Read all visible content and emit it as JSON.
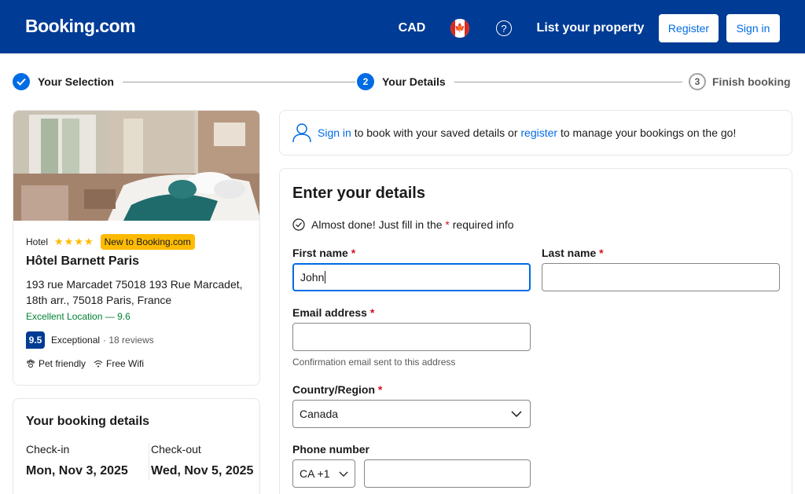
{
  "header": {
    "logo": "Booking.com",
    "currency": "CAD",
    "help_symbol": "?",
    "list_property": "List your property",
    "register": "Register",
    "sign_in": "Sign in",
    "brand_color": "#003b95",
    "accent_color": "#006ce4"
  },
  "progress": {
    "steps": [
      {
        "number": "✓",
        "label": "Your Selection",
        "state": "done"
      },
      {
        "number": "2",
        "label": "Your Details",
        "state": "current"
      },
      {
        "number": "3",
        "label": "Finish booking",
        "state": "upcoming"
      }
    ]
  },
  "hotel": {
    "type": "Hotel",
    "stars": "★★★★",
    "badge": "New to Booking.com",
    "name": "Hôtel Barnett Paris",
    "address": "193 rue Marcadet 75018 193 Rue Marcadet, 18th arr., 75018 Paris, France",
    "location": "Excellent Location — 9.6",
    "score": "9.5",
    "score_word": "Exceptional",
    "reviews": "· 18 reviews",
    "amenities": [
      "Pet friendly",
      "Free Wifi"
    ]
  },
  "booking": {
    "title": "Your booking details",
    "checkin_label": "Check-in",
    "checkin_value": "Mon, Nov 3, 2025",
    "checkout_label": "Check-out",
    "checkout_value": "Wed, Nov 5, 2025"
  },
  "signin_banner": {
    "sign_in_link": "Sign in",
    "text_middle": " to book with your saved details or ",
    "register_link": "register",
    "text_end": " to manage your bookings on the go!"
  },
  "form": {
    "title": "Enter your details",
    "almost_done_prefix": "Almost done! Just fill in the ",
    "required_mark": "*",
    "almost_done_suffix": " required info",
    "first_name_label": "First name",
    "first_name_value": "John",
    "last_name_label": "Last name",
    "last_name_value": "",
    "email_label": "Email address",
    "email_value": "",
    "email_helper": "Confirmation email sent to this address",
    "country_label": "Country/Region",
    "country_value": "Canada",
    "phone_label": "Phone number",
    "phone_code": "CA +1",
    "phone_value": ""
  }
}
